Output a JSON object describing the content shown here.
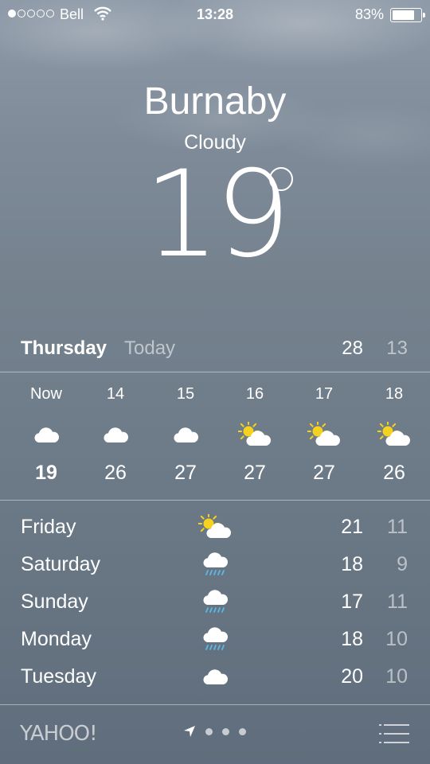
{
  "status_bar": {
    "signal": {
      "filled": 1,
      "total": 5
    },
    "carrier": "Bell",
    "time": "13:28",
    "battery_percent": "83%",
    "battery_level": 0.83
  },
  "location": {
    "city": "Burnaby",
    "condition": "Cloudy",
    "temperature": "19"
  },
  "today": {
    "day": "Thursday",
    "label": "Today",
    "high": "28",
    "low": "13"
  },
  "hourly": [
    {
      "time": "Now",
      "icon": "cloud-icon",
      "temp": "19"
    },
    {
      "time": "14",
      "icon": "cloud-icon",
      "temp": "26"
    },
    {
      "time": "15",
      "icon": "cloud-icon",
      "temp": "27"
    },
    {
      "time": "16",
      "icon": "partly-sunny-icon",
      "temp": "27"
    },
    {
      "time": "17",
      "icon": "partly-sunny-icon",
      "temp": "27"
    },
    {
      "time": "18",
      "icon": "partly-sunny-icon",
      "temp": "26"
    }
  ],
  "daily": [
    {
      "day": "Friday",
      "icon": "partly-sunny-icon",
      "high": "21",
      "low": "11"
    },
    {
      "day": "Saturday",
      "icon": "rain-icon",
      "high": "18",
      "low": "9"
    },
    {
      "day": "Sunday",
      "icon": "rain-icon",
      "high": "17",
      "low": "11"
    },
    {
      "day": "Monday",
      "icon": "rain-icon",
      "high": "18",
      "low": "10"
    },
    {
      "day": "Tuesday",
      "icon": "cloud-icon",
      "high": "20",
      "low": "10"
    }
  ],
  "footer": {
    "brand": "YAHOO!",
    "page_dots": 3,
    "icons": [
      "location-arrow-icon",
      "city-list-icon"
    ]
  },
  "colors": {
    "sun": "#f5d21f",
    "rain": "#5ab8e8",
    "muted_text": "rgba(255,255,255,0.55)"
  }
}
